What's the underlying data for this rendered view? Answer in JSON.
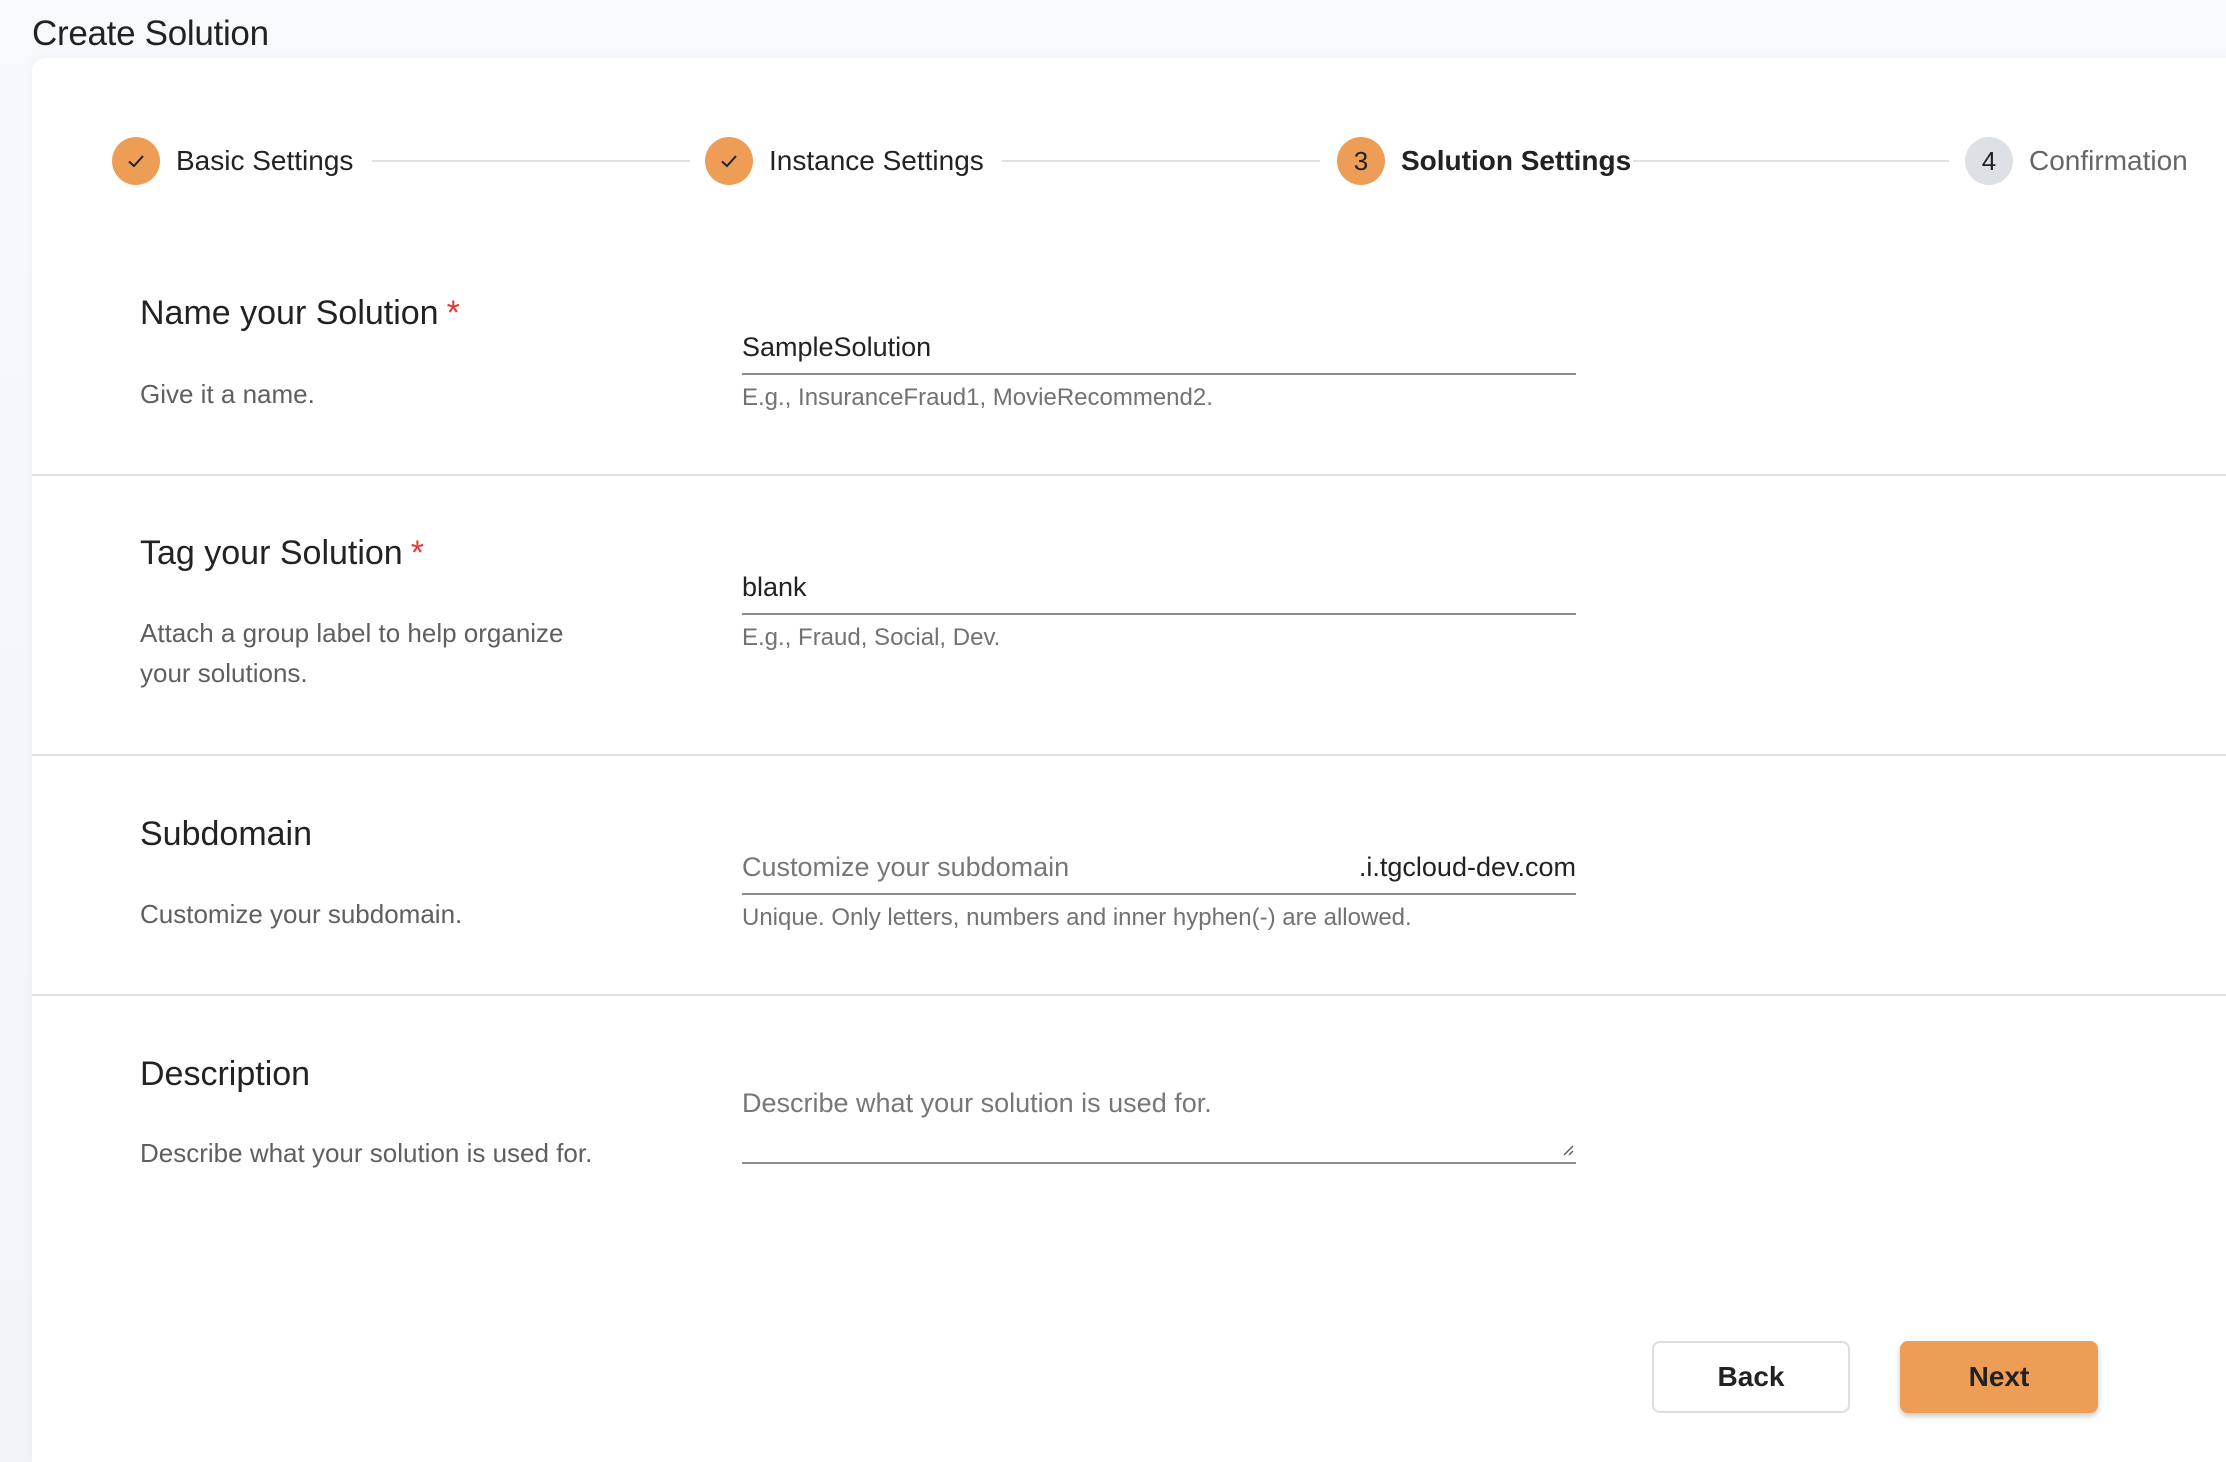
{
  "page": {
    "title": "Create Solution"
  },
  "colors": {
    "accent": "#ed9d56",
    "pending_step": "#dde0e4",
    "required": "#e53935"
  },
  "stepper": {
    "steps": [
      {
        "number": "1",
        "label": "Basic Settings",
        "state": "completed",
        "icon": "check-icon"
      },
      {
        "number": "2",
        "label": "Instance Settings",
        "state": "completed",
        "icon": "check-icon"
      },
      {
        "number": "3",
        "label": "Solution Settings",
        "state": "active"
      },
      {
        "number": "4",
        "label": "Confirmation",
        "state": "pending"
      }
    ]
  },
  "form": {
    "name": {
      "title": "Name your Solution",
      "required_mark": "*",
      "description": "Give it a name.",
      "value": "SampleSolution",
      "help": "E.g., InsuranceFraud1, MovieRecommend2."
    },
    "tag": {
      "title": "Tag your Solution",
      "required_mark": "*",
      "description": "Attach a group label to help organize your solutions.",
      "value": "blank",
      "help": "E.g., Fraud, Social, Dev."
    },
    "subdomain": {
      "title": "Subdomain",
      "description": "Customize your subdomain.",
      "value": "",
      "placeholder": "Customize your subdomain",
      "suffix": ".i.tgcloud-dev.com",
      "help": "Unique. Only letters, numbers and inner hyphen(-) are allowed."
    },
    "description": {
      "title": "Description",
      "description": "Describe what your solution is used for.",
      "value": "",
      "placeholder": "Describe what your solution is used for."
    }
  },
  "actions": {
    "back_label": "Back",
    "next_label": "Next"
  }
}
